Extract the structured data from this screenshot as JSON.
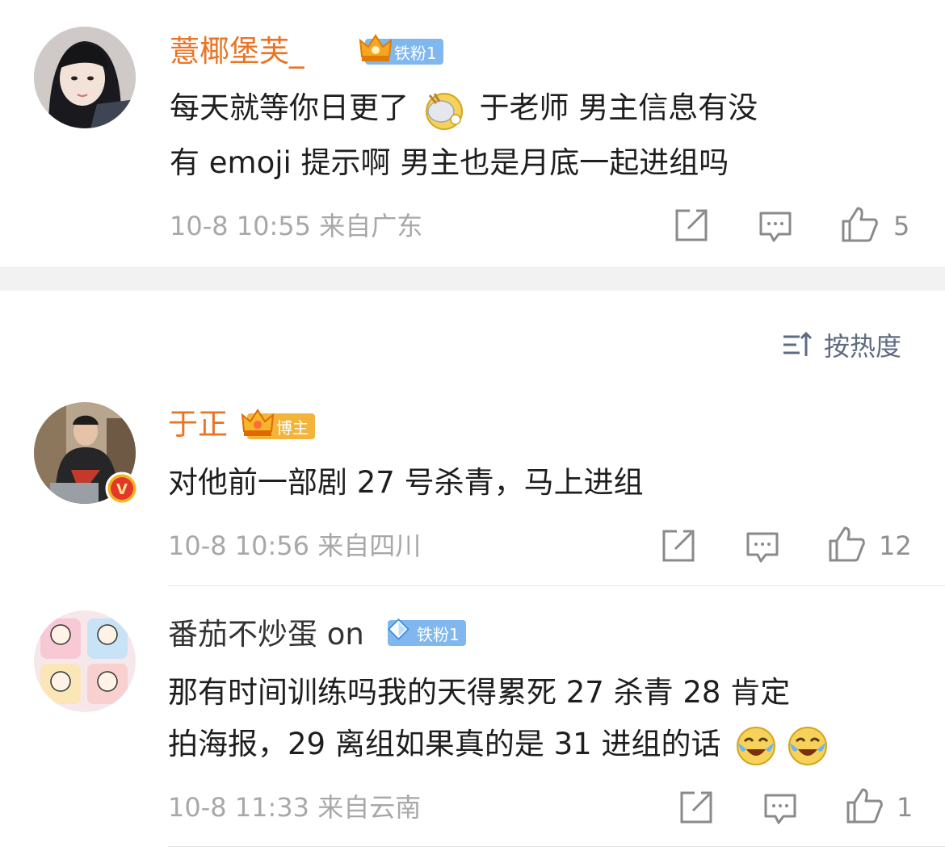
{
  "comments": [
    {
      "username": "薏椰堡芙_",
      "badge": "铁粉1",
      "text_line1_a": "每天就等你日更了",
      "text_line1_b": "于老师 男主信息有没",
      "text_line2": "有 emoji 提示啊 男主也是月底一起进组吗",
      "meta": "10-8 10:55 来自广东",
      "likes": "5"
    },
    {
      "username": "于正",
      "badge": "博主",
      "verified": "V",
      "text_line1": "对他前一部剧 27 号杀青，马上进组",
      "meta": "10-8 10:56 来自四川",
      "likes": "12"
    },
    {
      "username": "番茄不炒蛋 on",
      "badge": "铁粉1",
      "text_line1": "那有时间训练吗我的天得累死 27 杀青 28 肯定",
      "text_line2": "拍海报，29 离组如果真的是 31 进组的话",
      "meta": "10-8 11:33 来自云南",
      "likes": "1"
    }
  ],
  "sort": {
    "label": "按热度"
  },
  "colors": {
    "username_orange": "#eb7324",
    "badge_blue": "#7fb7ee",
    "badge_gold": "#f2b43a",
    "meta_gray": "#a8a8a8"
  },
  "icons": [
    "share-icon",
    "comment-icon",
    "like-icon",
    "sort-icon",
    "crown-icon",
    "diamond-icon",
    "verified-icon"
  ]
}
